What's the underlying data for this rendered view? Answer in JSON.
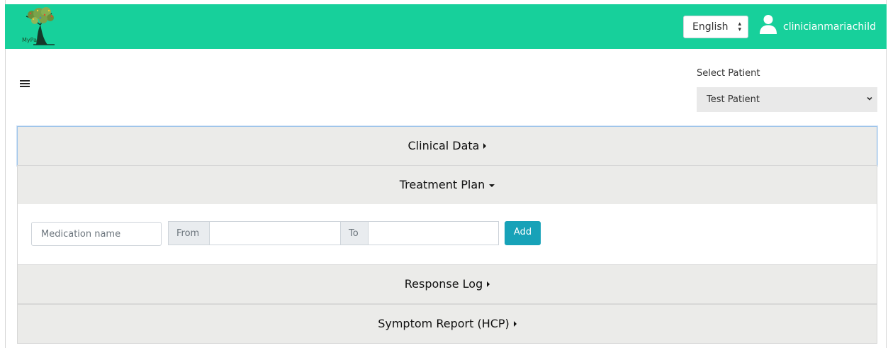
{
  "app": {
    "logo_text": "MyPal",
    "brand_color": "#17d09b"
  },
  "header": {
    "language": "English",
    "username": "clinicianmariachild"
  },
  "patient": {
    "label": "Select Patient",
    "selected": "Test Patient"
  },
  "accordion": {
    "clinical_data": "Clinical Data",
    "treatment_plan": "Treatment Plan",
    "response_log": "Response Log",
    "symptom_report": "Symptom Report (HCP)"
  },
  "treatment_form": {
    "medication_placeholder": "Medication name",
    "from_label": "From",
    "to_label": "To",
    "add_label": "Add"
  },
  "colors": {
    "add_button": "#17a2b8",
    "accordion_bg": "#ebebe9"
  },
  "icons": {
    "menu": "hamburger-icon",
    "user": "user-icon",
    "caret_collapsed": "caret-right-icon",
    "caret_expanded": "caret-down-icon"
  }
}
